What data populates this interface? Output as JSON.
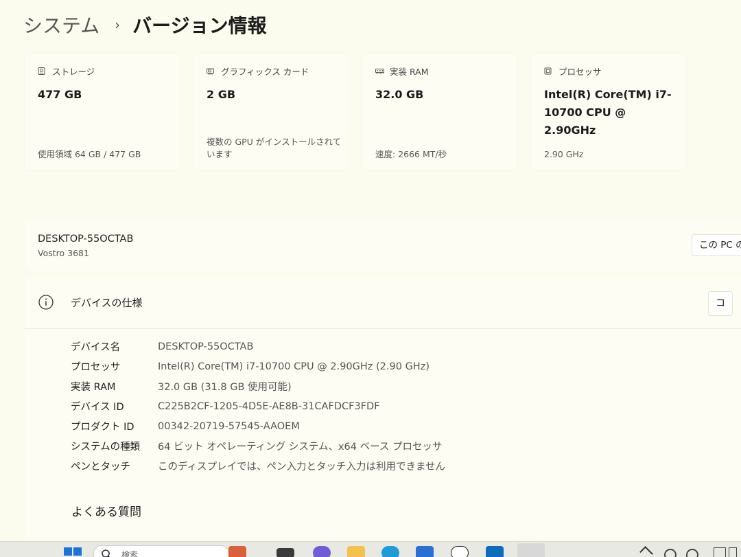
{
  "breadcrumb": {
    "parent": "システム",
    "separator": "›",
    "current": "バージョン情報"
  },
  "cards": [
    {
      "title": "ストレージ",
      "icon": "storage-icon",
      "value": "477 GB",
      "sub": "使用領域 64 GB / 477 GB"
    },
    {
      "title": "グラフィックス カード",
      "icon": "graphics-card-icon",
      "value": "2 GB",
      "sub": "複数の GPU がインストールされています"
    },
    {
      "title": "実装 RAM",
      "icon": "ram-icon",
      "value": "32.0 GB",
      "sub": "速度: 2666 MT/秒"
    },
    {
      "title": "プロセッサ",
      "icon": "processor-icon",
      "value": "Intel(R) Core(TM) i7-10700 CPU @ 2.90GHz",
      "sub": "2.90 GHz"
    }
  ],
  "device": {
    "name": "DESKTOP-55OCTAB",
    "model": "Vostro 3681",
    "rename_button": "この PC の"
  },
  "specs": {
    "title": "デバイスの仕様",
    "copy_button": "コ",
    "rows": [
      {
        "label": "デバイス名",
        "value": "DESKTOP-55OCTAB"
      },
      {
        "label": "プロセッサ",
        "value": "Intel(R) Core(TM) i7-10700 CPU @ 2.90GHz (2.90 GHz)"
      },
      {
        "label": "実装 RAM",
        "value": "32.0 GB (31.8 GB 使用可能)"
      },
      {
        "label": "デバイス ID",
        "value": "C225B2CF-1205-4D5E-AE8B-31CAFDCF3FDF"
      },
      {
        "label": "プロダクト ID",
        "value": "00342-20719-57545-AAOEM"
      },
      {
        "label": "システムの種類",
        "value": "64 ビット オペレーティング システム、x64 ベース プロセッサ"
      },
      {
        "label": "ペンとタッチ",
        "value": "このディスプレイでは、ペン入力とタッチ入力は利用できません"
      }
    ]
  },
  "faq": {
    "title": "よくある質問"
  },
  "taskbar": {
    "search_placeholder": "検索",
    "apps": [
      "widgets-icon",
      "task-view-icon",
      "copilot-icon",
      "file-explorer-icon",
      "edge-icon",
      "store-icon",
      "dell-icon",
      "outlook-icon",
      "settings-icon"
    ],
    "colors": {
      "start": "#1a73d9",
      "explorer": "#f2c14e",
      "edge": "#1f9bd6",
      "store": "#2b6fd6",
      "outlook": "#0f6cbd"
    }
  }
}
